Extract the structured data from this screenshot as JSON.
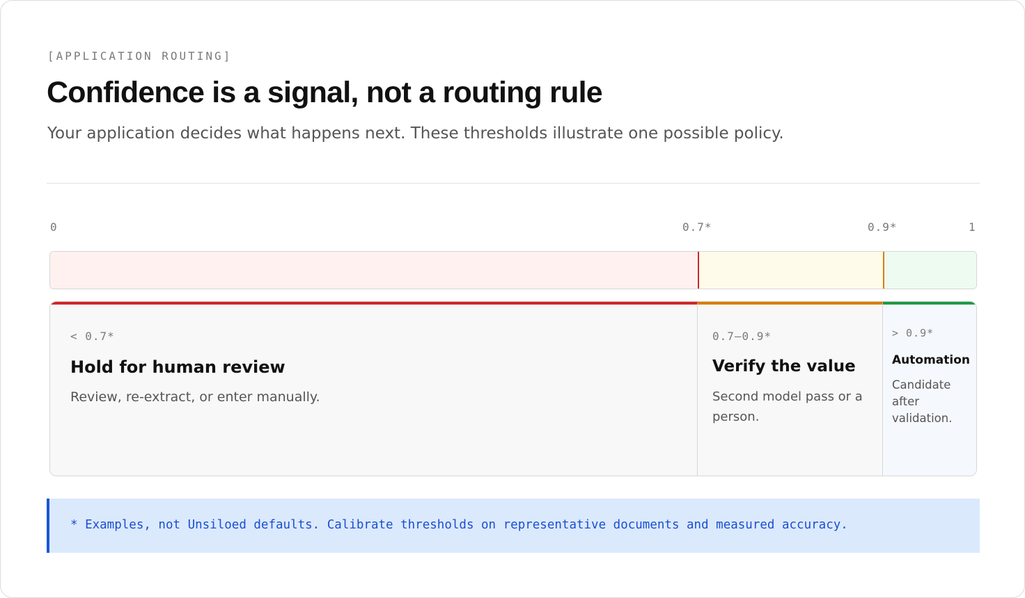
{
  "header": {
    "eyebrow": "[APPLICATION ROUTING]",
    "title": "Confidence is a signal, not a routing rule",
    "subtitle": "Your application decides what happens next. These thresholds illustrate one possible policy."
  },
  "scale": {
    "ticks": [
      {
        "label": "0",
        "value": 0
      },
      {
        "label": "0.7*",
        "value": 0.7
      },
      {
        "label": "0.9*",
        "value": 0.9
      },
      {
        "label": "1",
        "value": 1
      }
    ],
    "segments": [
      {
        "from": 0,
        "to": 0.7,
        "color": "#d0262b",
        "fill": "#fff1f0"
      },
      {
        "from": 0.7,
        "to": 0.9,
        "color": "#d97e0a",
        "fill": "#fffbea"
      },
      {
        "from": 0.9,
        "to": 1,
        "color": "#1f9a47",
        "fill": "#eefbf1"
      }
    ]
  },
  "panels": [
    {
      "range": "< 0.7*",
      "title": "Hold for human review",
      "description": "Review, re-extract, or enter manually."
    },
    {
      "range": "0.7—0.9*",
      "title": "Verify the value",
      "description": "Second model pass or a person."
    },
    {
      "range": "> 0.9*",
      "title": "Automation",
      "description": "Candidate after validation."
    }
  ],
  "note": {
    "text": "* Examples, not Unsiloed defaults. Calibrate thresholds on representative documents and measured accuracy.",
    "accent": "#1a56d6"
  }
}
